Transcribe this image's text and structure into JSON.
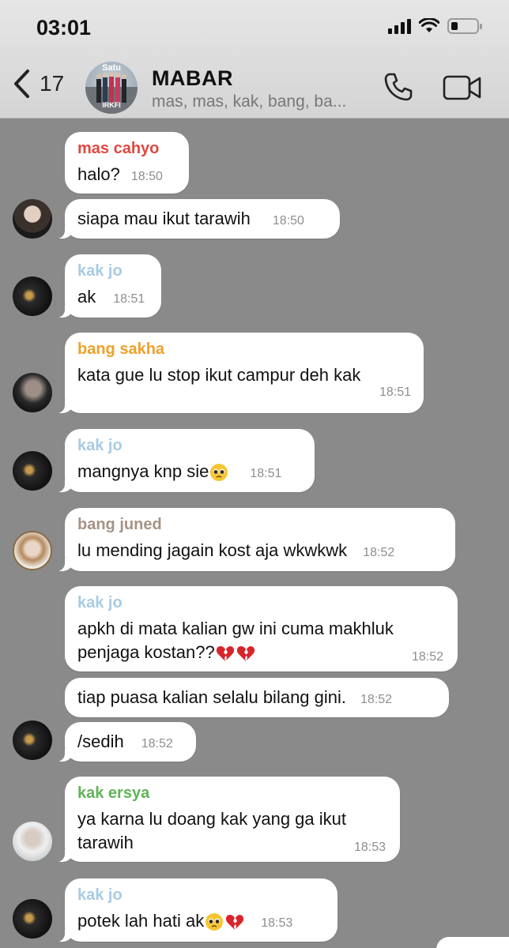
{
  "status_bar": {
    "time": "03:01"
  },
  "header": {
    "back_count": "17",
    "avatar_text": "Satu",
    "avatar_text_bottom": "IRKFI",
    "title": "MABAR",
    "subtitle": "mas, mas, kak, bang, ba..."
  },
  "colors": {
    "mas_cahyo": "#e0483e",
    "kak_jo": "#a7cbe4",
    "bang_sakha": "#f0a12a",
    "bang_juned": "#a69385",
    "kak_ersya": "#5fb458"
  },
  "messages": [
    {
      "sender": "mas cahyo",
      "text": "halo?",
      "time": "18:50"
    },
    {
      "text": "siapa mau ikut tarawih",
      "time": "18:50"
    },
    {
      "sender": "kak jo",
      "text": "ak",
      "time": "18:51"
    },
    {
      "sender": "bang sakha",
      "text": "kata gue lu stop ikut campur deh kak",
      "time": "18:51"
    },
    {
      "sender": "kak jo",
      "text": "mangnya knp sie",
      "emoji": [
        "pleading-face"
      ],
      "time": "18:51"
    },
    {
      "sender": "bang juned",
      "text": "lu mending jagain kost aja wkwkwk",
      "time": "18:52"
    },
    {
      "sender": "kak jo",
      "text_line1": "apkh di mata kalian gw ini cuma makhluk",
      "text_line2": "penjaga kostan??",
      "emoji": [
        "broken-heart",
        "broken-heart"
      ],
      "time": "18:52"
    },
    {
      "text": "tiap puasa kalian selalu bilang gini.",
      "time": "18:52"
    },
    {
      "text": "/sedih",
      "time": "18:52"
    },
    {
      "sender": "kak ersya",
      "text_line1": "ya karna lu doang kak yang ga ikut",
      "text_line2": "tarawih",
      "time": "18:53"
    },
    {
      "sender": "kak jo",
      "text": "potek lah hati ak",
      "emoji": [
        "pleading-face",
        "broken-heart"
      ],
      "time": "18:53"
    }
  ]
}
